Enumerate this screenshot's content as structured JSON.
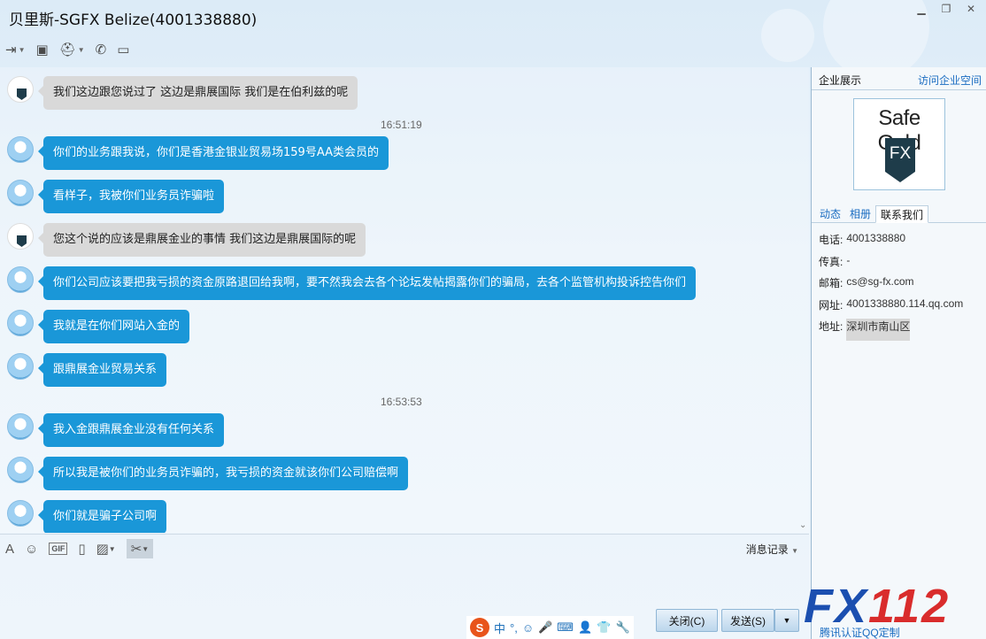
{
  "window": {
    "title": "贝里斯-SGFX Belize(4001338880)",
    "controls": [
      "minimize",
      "restore",
      "close"
    ]
  },
  "toolbar": {
    "items": [
      "transfer-file-icon",
      "remote-desktop-icon",
      "app-icon",
      "phone-icon",
      "video-icon"
    ]
  },
  "chat": {
    "messages": [
      {
        "kind": "msg",
        "sender": "company",
        "text": "我们这边跟您说过了 这边是鼎展国际 我们是在伯利兹的呢"
      },
      {
        "kind": "time",
        "text": "16:51:19"
      },
      {
        "kind": "msg",
        "sender": "user",
        "text": "你们的业务跟我说，你们是香港金银业贸易场159号AA类会员的"
      },
      {
        "kind": "msg",
        "sender": "user",
        "text": "看样子，我被你们业务员诈骗啦"
      },
      {
        "kind": "msg",
        "sender": "company",
        "text": "您这个说的应该是鼎展金业的事情 我们这边是鼎展国际的呢"
      },
      {
        "kind": "msg",
        "sender": "user",
        "text": "你们公司应该要把我亏损的资金原路退回给我啊，要不然我会去各个论坛发帖揭露你们的骗局，去各个监管机构投诉控告你们"
      },
      {
        "kind": "msg",
        "sender": "user",
        "text": "我就是在你们网站入金的"
      },
      {
        "kind": "msg",
        "sender": "user",
        "text": "跟鼎展金业贸易关系"
      },
      {
        "kind": "time",
        "text": "16:53:53"
      },
      {
        "kind": "msg",
        "sender": "user",
        "text": "我入金跟鼎展金业没有任何关系"
      },
      {
        "kind": "msg",
        "sender": "user",
        "text": "所以我是被你们的业务员诈骗的，我亏损的资金就该你们公司赔偿啊"
      },
      {
        "kind": "msg",
        "sender": "user",
        "text": "你们就是骗子公司啊"
      }
    ]
  },
  "input_toolbar": {
    "history_label": "消息记录"
  },
  "ime": {
    "logo": "S",
    "chars": [
      "中",
      "°,",
      "☺",
      "🎤",
      "⌨",
      "👤",
      "👕",
      "🔧"
    ]
  },
  "buttons": {
    "close": "关闭(C)",
    "send": "发送(S)"
  },
  "side": {
    "title": "企业展示",
    "link": "访问企业空间",
    "logo_text": "Safe Gold",
    "logo_mark": "FX",
    "tabs": [
      "动态",
      "相册",
      "联系我们"
    ],
    "active_tab": 2,
    "contact": [
      {
        "label": "电话:",
        "value": "4001338880"
      },
      {
        "label": "传真:",
        "value": "-"
      },
      {
        "label": "邮箱:",
        "value": "cs@sg-fx.com"
      },
      {
        "label": "网址:",
        "value": "4001338880.114.qq.com"
      },
      {
        "label": "地址:",
        "value": "深圳市南山区"
      }
    ]
  },
  "watermark": {
    "brand_blue": "FX",
    "brand_red": "112",
    "sub": "腾讯认证QQ定制"
  },
  "colors": {
    "bubble_blue": "#1a97d8",
    "bubble_gray": "#d9d9d9",
    "link": "#1a6cc1"
  }
}
